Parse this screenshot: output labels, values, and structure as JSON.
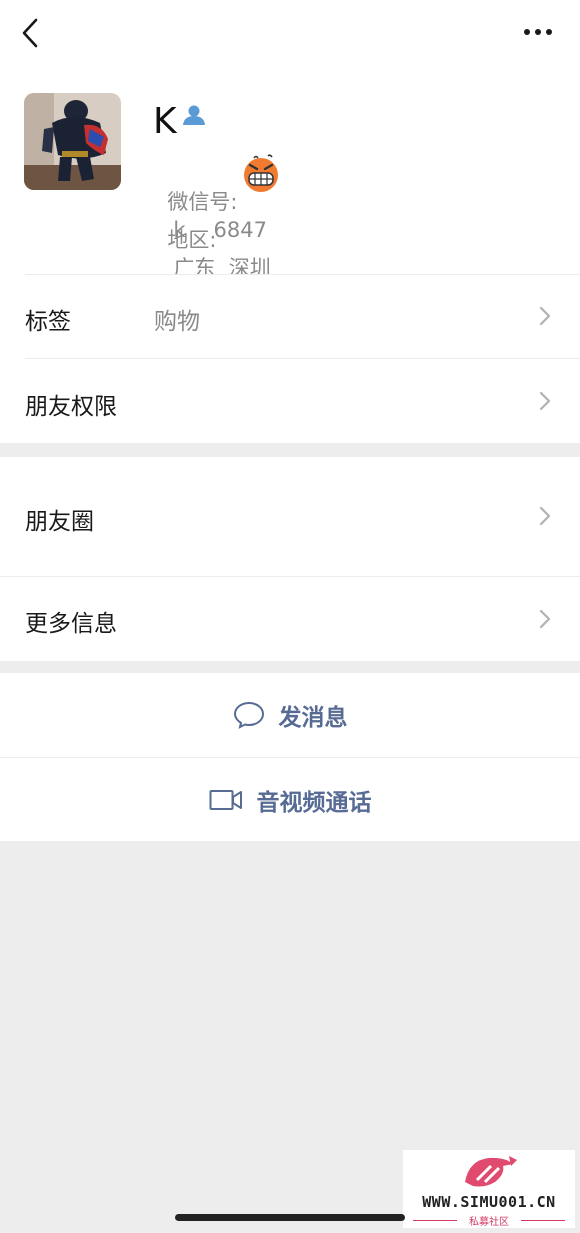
{
  "profile": {
    "name": "K",
    "wechat_id_label": "微信号:",
    "wechat_id_value": "k",
    "wechat_id_tail": "6847",
    "region_label": "地区:",
    "region_value": "广东  深圳",
    "contact_icon": "contact-person-icon",
    "avatar": "spiderman-figure-avatar"
  },
  "rows": {
    "tags_label": "标签",
    "tags_value": "购物",
    "permissions_label": "朋友权限",
    "moments_label": "朋友圈",
    "more_info_label": "更多信息"
  },
  "actions": {
    "send_message": "发消息",
    "video_call": "音视频通话"
  },
  "watermark": {
    "url": "WWW.SIMU001.CN",
    "caption": "私募社区"
  },
  "colors": {
    "link_blue": "#576b95",
    "background": "#ededed",
    "contact_icon_blue": "#5b9bd5",
    "watermark_red": "#d43a63"
  }
}
